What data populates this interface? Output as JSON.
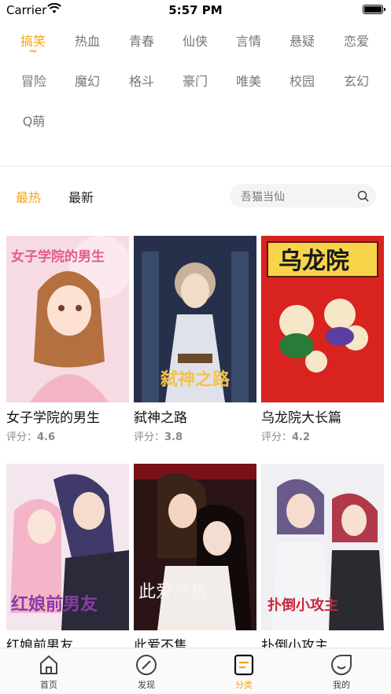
{
  "status_bar": {
    "carrier": "Carrier",
    "time": "5:57 PM"
  },
  "genres": [
    {
      "label": "搞笑",
      "active": true
    },
    {
      "label": "热血",
      "active": false
    },
    {
      "label": "青春",
      "active": false
    },
    {
      "label": "仙侠",
      "active": false
    },
    {
      "label": "言情",
      "active": false
    },
    {
      "label": "悬疑",
      "active": false
    },
    {
      "label": "恋爱",
      "active": false
    },
    {
      "label": "冒险",
      "active": false
    },
    {
      "label": "魔幻",
      "active": false
    },
    {
      "label": "格斗",
      "active": false
    },
    {
      "label": "豪门",
      "active": false
    },
    {
      "label": "唯美",
      "active": false
    },
    {
      "label": "校园",
      "active": false
    },
    {
      "label": "玄幻",
      "active": false
    },
    {
      "label": "Q萌",
      "active": false
    }
  ],
  "sort": {
    "hot": "最热",
    "new": "最新",
    "active": "hot"
  },
  "search": {
    "placeholder": "吾猫当仙"
  },
  "score_label": "评分：",
  "comics": [
    {
      "title": "女子学院的男生",
      "score": "4.6",
      "cover_text": "女子学院的男生",
      "cover_bg": "#f6d9e2"
    },
    {
      "title": "弑神之路",
      "score": "3.8",
      "cover_text": "弑神之路",
      "cover_bg": "#2a3350"
    },
    {
      "title": "乌龙院大长篇",
      "score": "4.2",
      "cover_text": "乌龙院",
      "cover_bg": "#d8231f"
    },
    {
      "title": "红娘前男友",
      "score": "",
      "cover_text": "红娘前男友",
      "cover_bg": "#f3e6ee"
    },
    {
      "title": "此爱不售",
      "score": "",
      "cover_text": "此爱不售",
      "cover_bg": "#2b1416"
    },
    {
      "title": "扑倒小攻主",
      "score": "",
      "cover_text": "扑倒小攻主",
      "cover_bg": "#eeeef3"
    }
  ],
  "tabs": [
    {
      "label": "首页",
      "icon": "home-icon",
      "active": false
    },
    {
      "label": "发现",
      "icon": "compass-icon",
      "active": false
    },
    {
      "label": "分类",
      "icon": "category-icon",
      "active": true
    },
    {
      "label": "我的",
      "icon": "profile-icon",
      "active": false
    }
  ],
  "colors": {
    "accent": "#f2a516",
    "text": "#222222",
    "muted": "#777777"
  }
}
